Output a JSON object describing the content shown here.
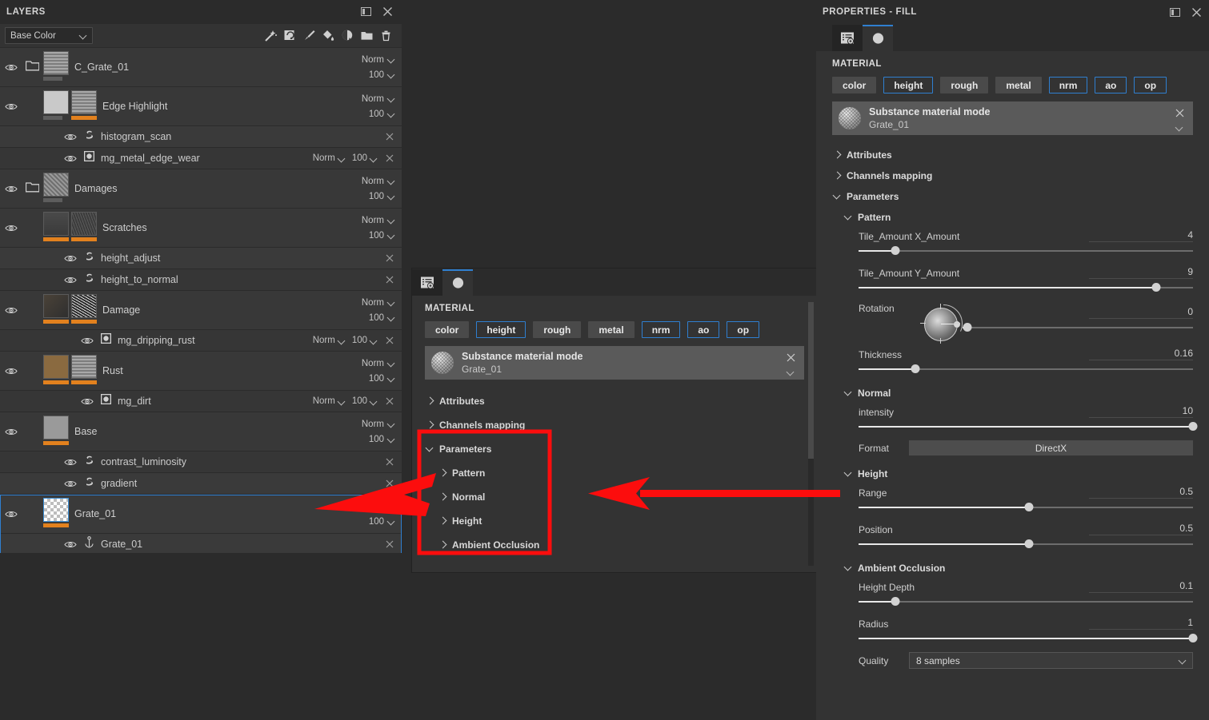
{
  "layers_panel": {
    "title": "LAYERS",
    "header_icons": [
      "dock-icon",
      "close-icon"
    ],
    "blend_channel": {
      "value": "Base Color"
    },
    "toolbar_icons": [
      "magic-wand-icon",
      "smart-mask-icon",
      "paint-brush-icon",
      "paint-bucket-icon",
      "mask-icon",
      "new-folder-icon",
      "delete-icon"
    ],
    "layers": [
      {
        "name": "C_Grate_01",
        "type": "folder",
        "blend": "Norm",
        "opacity": "100",
        "visible": true,
        "thumbs": [
          "grate"
        ],
        "bars": [
          "grey"
        ]
      },
      {
        "name": "Edge Highlight",
        "type": "fill",
        "blend": "Norm",
        "opacity": "100",
        "visible": true,
        "thumbs": [
          "flat",
          "grate"
        ],
        "bars": [
          "grey",
          "orange"
        ]
      },
      {
        "name": "histogram_scan",
        "type": "effect",
        "icon": "substance-effect-icon",
        "visible": true,
        "indent": 1
      },
      {
        "name": "mg_metal_edge_wear",
        "type": "generator",
        "icon": "mask-generator-icon",
        "blend": "Norm",
        "opacity": "100",
        "visible": true,
        "indent": 1
      },
      {
        "name": "Damages",
        "type": "folder",
        "blend": "Norm",
        "opacity": "100",
        "visible": true,
        "thumbs": [
          "noise"
        ],
        "bars": [
          "grey"
        ]
      },
      {
        "name": "Scratches",
        "type": "fill",
        "blend": "Norm",
        "opacity": "100",
        "visible": true,
        "thumbs": [
          "paint",
          "scratch"
        ],
        "bars": [
          "orange",
          "orange"
        ]
      },
      {
        "name": "height_adjust",
        "type": "effect",
        "icon": "substance-effect-icon",
        "visible": true,
        "indent": 1
      },
      {
        "name": "height_to_normal",
        "type": "effect",
        "icon": "substance-effect-icon",
        "visible": true,
        "indent": 1
      },
      {
        "name": "Damage",
        "type": "fill",
        "blend": "Norm",
        "opacity": "100",
        "visible": true,
        "thumbs": [
          "dark",
          "damage"
        ],
        "bars": [
          "orange",
          "orange"
        ]
      },
      {
        "name": "mg_dripping_rust",
        "type": "generator",
        "icon": "mask-generator-icon",
        "blend": "Norm",
        "opacity": "100",
        "visible": true,
        "indent": 2
      },
      {
        "name": "Rust",
        "type": "fill",
        "blend": "Norm",
        "opacity": "100",
        "visible": true,
        "thumbs": [
          "rust",
          "grate"
        ],
        "bars": [
          "orange",
          "orange"
        ]
      },
      {
        "name": "mg_dirt",
        "type": "generator",
        "icon": "mask-generator-icon",
        "blend": "Norm",
        "opacity": "100",
        "visible": true,
        "indent": 2
      },
      {
        "name": "Base",
        "type": "fill",
        "blend": "Norm",
        "opacity": "100",
        "visible": true,
        "thumbs": [
          "grey"
        ],
        "bars": [
          "orange"
        ]
      },
      {
        "name": "contrast_luminosity",
        "type": "effect",
        "icon": "substance-effect-icon",
        "visible": true,
        "indent": 1
      },
      {
        "name": "gradient",
        "type": "effect",
        "icon": "substance-effect-icon",
        "visible": true,
        "indent": 1
      },
      {
        "name": "Grate_01",
        "type": "fill",
        "blend": "Norm",
        "opacity": "100",
        "visible": true,
        "selected": true,
        "thumbs": [
          "checker"
        ],
        "bars": [
          "orange"
        ]
      },
      {
        "name": "Grate_01",
        "type": "anchor",
        "icon": "anchor-point-icon",
        "visible": true,
        "indent": 1,
        "selected": true
      }
    ]
  },
  "center_panel": {
    "tabs": [
      "properties-tab-icon",
      "material-tab-icon"
    ],
    "active_tab_index": 1,
    "section_label": "MATERIAL",
    "channels": [
      {
        "label": "color",
        "style": "filled"
      },
      {
        "label": "height",
        "style": "outlined-dark"
      },
      {
        "label": "rough",
        "style": "filled"
      },
      {
        "label": "metal",
        "style": "filled"
      },
      {
        "label": "nrm",
        "style": "outlined"
      },
      {
        "label": "ao",
        "style": "outlined"
      },
      {
        "label": "op",
        "style": "outlined"
      }
    ],
    "material": {
      "title": "Substance material mode",
      "subtitle": "Grate_01"
    },
    "tree": [
      {
        "label": "Attributes",
        "open": false,
        "level": 0
      },
      {
        "label": "Channels mapping",
        "open": false,
        "level": 0
      },
      {
        "label": "Parameters",
        "open": true,
        "level": 0
      },
      {
        "label": "Pattern",
        "open": false,
        "level": 1
      },
      {
        "label": "Normal",
        "open": false,
        "level": 1
      },
      {
        "label": "Height",
        "open": false,
        "level": 1
      },
      {
        "label": "Ambient Occlusion",
        "open": false,
        "level": 1
      }
    ]
  },
  "properties_panel": {
    "title": "PROPERTIES - FILL",
    "header_icons": [
      "dock-icon",
      "close-icon"
    ],
    "tabs": [
      "properties-tab-icon",
      "material-tab-icon"
    ],
    "active_tab_index": 1,
    "section_label": "MATERIAL",
    "channels": [
      {
        "label": "color",
        "style": "filled"
      },
      {
        "label": "height",
        "style": "outlined-dark"
      },
      {
        "label": "rough",
        "style": "filled"
      },
      {
        "label": "metal",
        "style": "filled"
      },
      {
        "label": "nrm",
        "style": "outlined"
      },
      {
        "label": "ao",
        "style": "outlined"
      },
      {
        "label": "op",
        "style": "outlined"
      }
    ],
    "material": {
      "title": "Substance material mode",
      "subtitle": "Grate_01"
    },
    "collapsed": [
      {
        "label": "Attributes"
      },
      {
        "label": "Channels mapping"
      }
    ],
    "parameters_label": "Parameters",
    "groups": [
      {
        "label": "Pattern",
        "params": [
          {
            "label": "Tile_Amount X_Amount",
            "value": "4",
            "fill": 0.11
          },
          {
            "label": "Tile_Amount Y_Amount",
            "value": "9",
            "fill": 0.89
          },
          {
            "label": "Rotation",
            "value": "0",
            "fill": 0.02,
            "widget": "dial"
          },
          {
            "label": "Thickness",
            "value": "0.16",
            "fill": 0.17
          }
        ]
      },
      {
        "label": "Normal",
        "params": [
          {
            "label": "intensity",
            "value": "10",
            "fill": 1.0
          },
          {
            "label": "Format",
            "value": "DirectX",
            "widget": "combo-center"
          }
        ]
      },
      {
        "label": "Height",
        "params": [
          {
            "label": "Range",
            "value": "0.5",
            "fill": 0.51
          },
          {
            "label": "Position",
            "value": "0.5",
            "fill": 0.51
          }
        ]
      },
      {
        "label": "Ambient Occlusion",
        "params": [
          {
            "label": "Height Depth",
            "value": "0.1",
            "fill": 0.11
          },
          {
            "label": "Radius",
            "value": "1",
            "fill": 1.0
          },
          {
            "label": "Quality",
            "value": "8 samples",
            "widget": "combo-left"
          }
        ]
      }
    ]
  },
  "annotations": {
    "highlight_box_label": "parameters-highlight-box",
    "highlight_color": "#fc0d0d",
    "arrows": [
      "arrow-pointing-to-selected-layer",
      "arrow-pointing-to-parameters-box"
    ]
  }
}
